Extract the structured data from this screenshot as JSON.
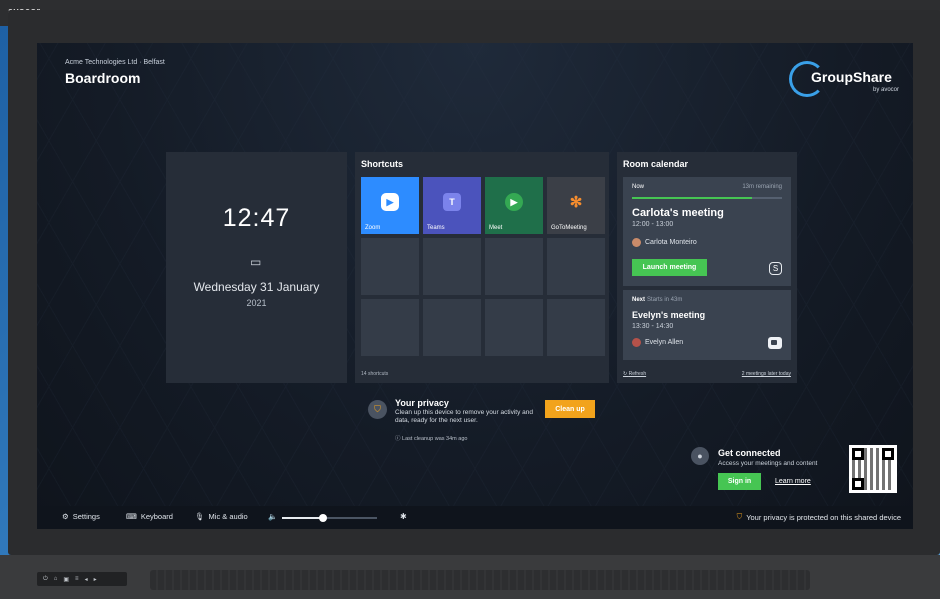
{
  "device": {
    "brand": "avocor"
  },
  "header": {
    "org": "Acme Technologies Ltd · Belfast",
    "room": "Boardroom"
  },
  "logo": {
    "name": "GroupShare",
    "by": "by avocor"
  },
  "clock": {
    "time": "12:47",
    "date": "Wednesday 31 January",
    "year": "2021",
    "icon": "calendar-icon"
  },
  "shortcuts": {
    "title": "Shortcuts",
    "tiles": [
      {
        "label": "Zoom",
        "color": "#2d8cff",
        "icon": "zoom-icon"
      },
      {
        "label": "Teams",
        "color": "#4b53bc",
        "icon": "teams-icon"
      },
      {
        "label": "Meet",
        "color": "#1f6f4a",
        "icon": "meet-icon"
      },
      {
        "label": "GoToMeeting",
        "color": "#3b3f47",
        "icon": "gotomeeting-icon"
      }
    ],
    "count": "14 shortcuts"
  },
  "calendar": {
    "title": "Room calendar",
    "now": {
      "label": "Now",
      "remaining": "13m remaining",
      "progress": 0.8,
      "title": "Carlota's meeting",
      "time": "12:00 - 13:00",
      "person": "Carlota Monteiro",
      "launch": "Launch meeting",
      "icon": "skype-icon"
    },
    "next": {
      "label": "Next",
      "starts": "Starts in 43m",
      "title": "Evelyn's meeting",
      "time": "13:30 - 14:30",
      "person": "Evelyn Allen",
      "icon": "zoom-icon"
    },
    "refresh": "Refresh",
    "later": "2 meetings later today"
  },
  "privacy": {
    "title": "Your privacy",
    "body": "Clean up this device to remove your activity and data, ready for the next user.",
    "last": "Last cleanup was 34m ago",
    "button": "Clean up"
  },
  "connect": {
    "title": "Get connected",
    "body": "Access your meetings and content",
    "signin": "Sign in",
    "learn": "Learn more"
  },
  "bottombar": {
    "settings": "Settings",
    "keyboard": "Keyboard",
    "mic": "Mic & audio",
    "volume": 0.43,
    "protected": "Your privacy is protected on this shared device"
  },
  "colors": {
    "accent_green": "#46c553",
    "accent_orange": "#f2a31c"
  }
}
